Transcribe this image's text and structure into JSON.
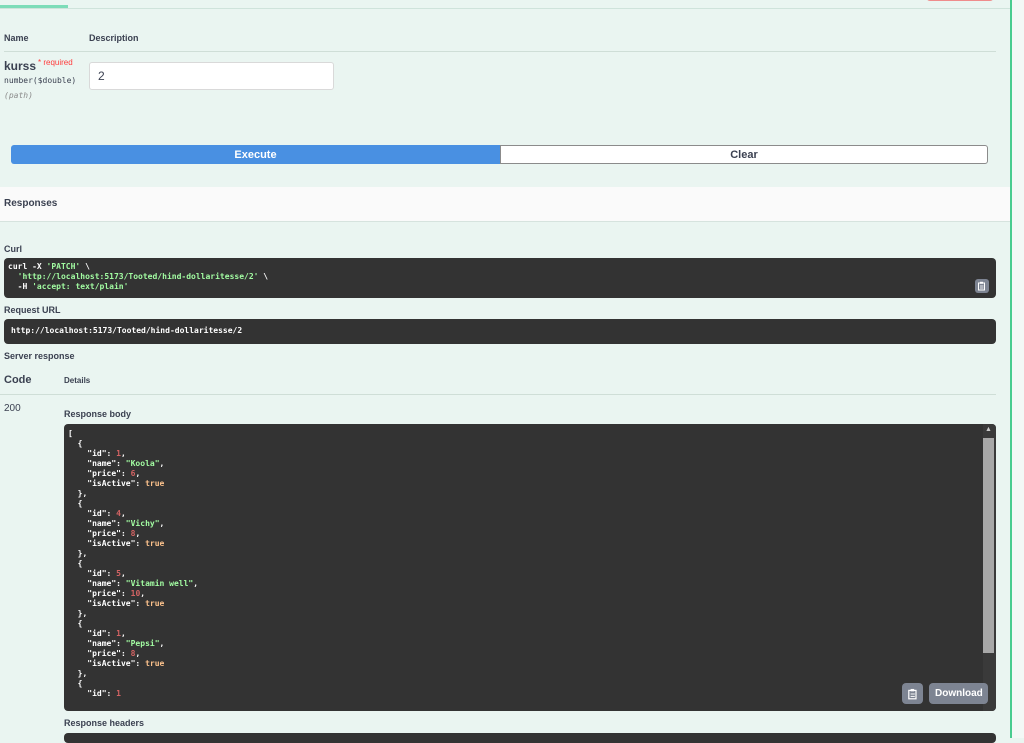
{
  "params": {
    "header_name": "Name",
    "header_description": "Description",
    "name": "kurss",
    "required_label": "* required",
    "type": "number($double)",
    "in": "(path)",
    "value": "2"
  },
  "actions": {
    "execute_label": "Execute",
    "clear_label": "Clear"
  },
  "responses": {
    "title": "Responses",
    "curl_label": "Curl",
    "curl_lines": {
      "l1_cmd": "curl -X ",
      "l1_method": "'PATCH'",
      "l1_tail": " \\",
      "l2_url": "'http://localhost:5173/Tooted/hind-dollaritesse/2'",
      "l2_tail": " \\",
      "l3_flag": "  -H ",
      "l3_header": "'accept: text/plain'"
    },
    "request_url_label": "Request URL",
    "request_url": "http://localhost:5173/Tooted/hind-dollaritesse/2",
    "server_response_label": "Server response",
    "code_header": "Code",
    "details_header": "Details",
    "code": "200",
    "response_body_label": "Response body",
    "response_headers_label": "Response headers",
    "download_label": "Download"
  },
  "response_body": [
    {
      "id": "1",
      "name": "\"Koola\"",
      "price": "6",
      "isActive": "true"
    },
    {
      "id": "4",
      "name": "\"Vichy\"",
      "price": "8",
      "isActive": "true"
    },
    {
      "id": "5",
      "name": "\"Vitamin well\"",
      "price": "10",
      "isActive": "true"
    },
    {
      "id": "1",
      "name": "\"Pepsi\"",
      "price": "8",
      "isActive": "true"
    },
    {
      "id": "1"
    }
  ],
  "colors": {
    "execute": "#4990e2",
    "code_bg": "#333333",
    "page_bg": "#eaf5f1",
    "accent": "#49cc90",
    "string": "#a2fca2",
    "number": "#d36363",
    "literal": "#fcc28c"
  },
  "icons": {
    "copy": "clipboard-icon"
  }
}
